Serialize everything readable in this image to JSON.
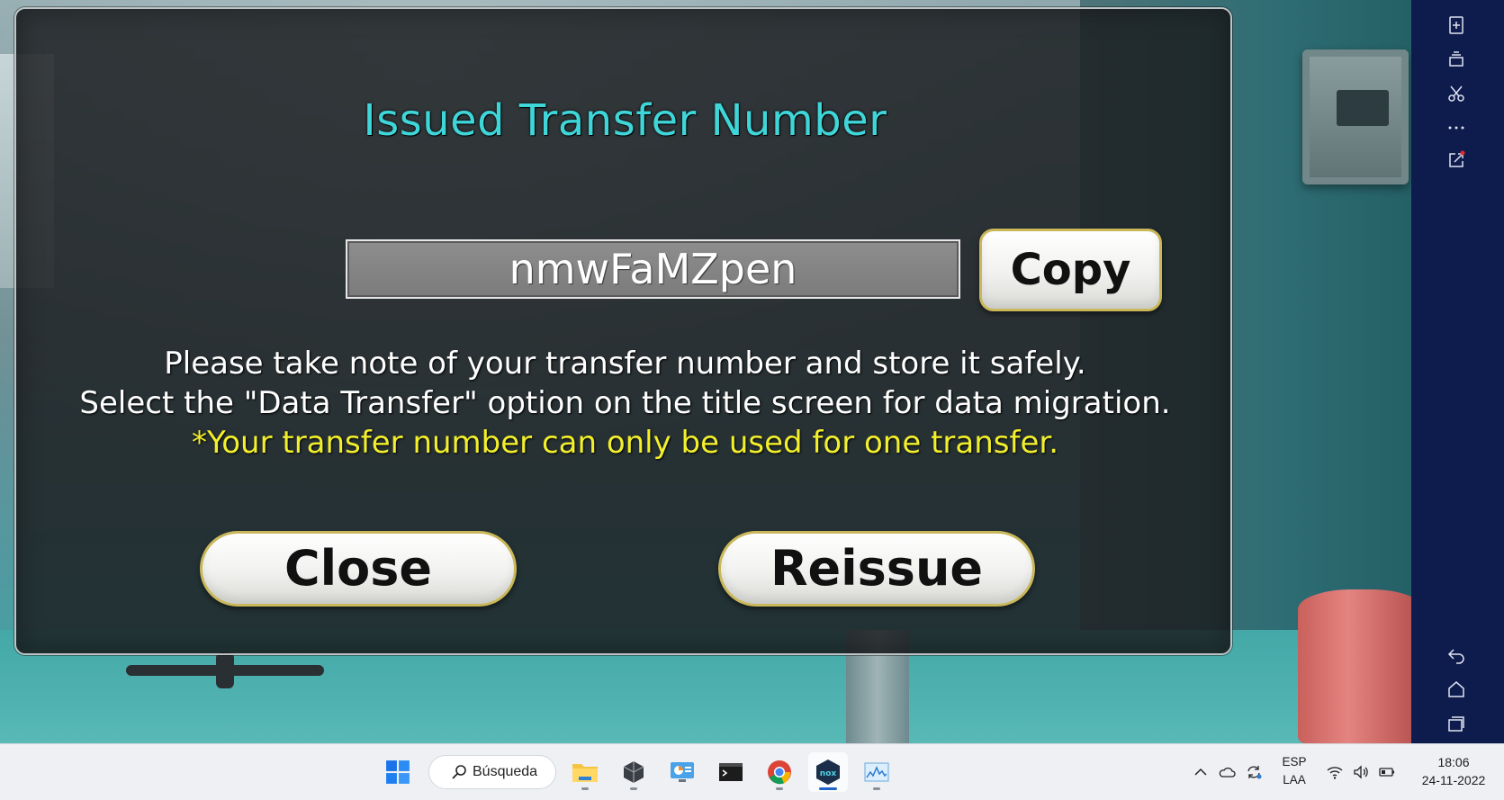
{
  "dialog": {
    "title": "Issued Transfer Number",
    "transfer_number": "nmwFaMZpen",
    "copy_label": "Copy",
    "message_line1": "Please take note of your transfer number and store it safely.",
    "message_line2": "Select the \"Data Transfer\" option on the title screen for data migration.",
    "warning_line": "*Your transfer number can only be used for one transfer.",
    "close_label": "Close",
    "reissue_label": "Reissue"
  },
  "colors": {
    "title_cyan": "#3fd6d9",
    "warning_yellow": "#f2ef2c",
    "sidebar_navy": "#0e1b4d",
    "button_gold_border": "#c9b75a"
  },
  "emulator_sidebar": {
    "icons": [
      "apk-install-icon",
      "multi-instance-icon",
      "screenshot-icon",
      "more-icon",
      "popout-icon",
      "back-icon",
      "home-icon",
      "recent-apps-icon"
    ]
  },
  "taskbar": {
    "search_label": "Búsqueda",
    "apps": [
      "start-icon",
      "file-explorer-icon",
      "unity-icon",
      "control-panel-icon",
      "terminal-icon",
      "chrome-icon",
      "nox-icon",
      "resource-monitor-icon"
    ],
    "active_app": "nox-icon",
    "language_top": "ESP",
    "language_bottom": "LAA",
    "time": "18:06",
    "date": "24-11-2022"
  }
}
